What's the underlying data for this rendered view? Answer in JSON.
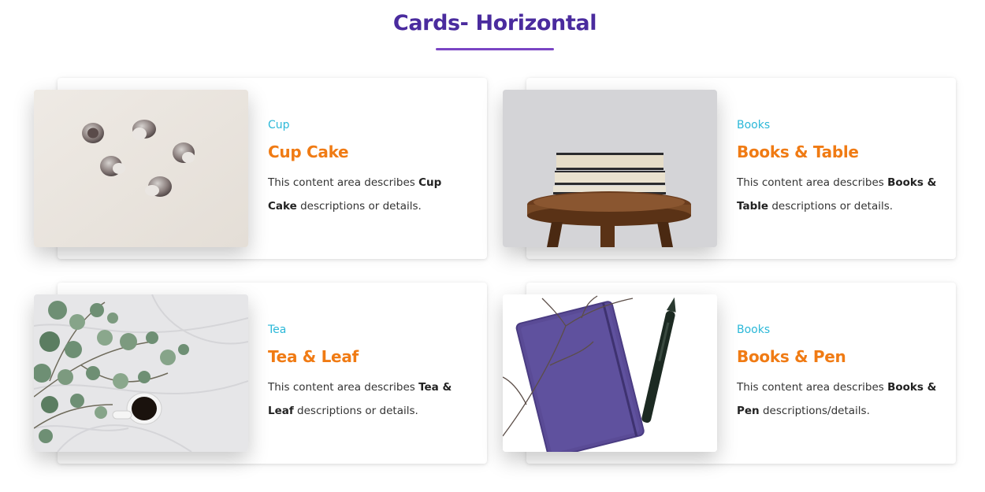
{
  "header": {
    "title": "Cards- Horizontal"
  },
  "cards": [
    {
      "category": "Cup",
      "title": "Cup Cake",
      "desc_pre": "This content area describes ",
      "desc_bold": "Cup Cake",
      "desc_post": " descriptions or details.",
      "image_icon": "coffee-capsules-photo"
    },
    {
      "category": "Books",
      "title": "Books & Table",
      "desc_pre": "This content area describes ",
      "desc_bold": "Books & Table",
      "desc_post": " descriptions or details.",
      "image_icon": "books-on-stool-photo"
    },
    {
      "category": "Tea",
      "title": "Tea & Leaf",
      "desc_pre": "This content area describes ",
      "desc_bold": "Tea & Leaf",
      "desc_post": " descriptions or details.",
      "image_icon": "tea-eucalyptus-photo"
    },
    {
      "category": "Books",
      "title": "Books & Pen",
      "desc_pre": "This content area describes ",
      "desc_bold": "Books & Pen",
      "desc_post": " descriptions/details.",
      "image_icon": "notebook-pen-photo"
    }
  ],
  "colors": {
    "title": "#4a2b9e",
    "underline": "#7a45c4",
    "category": "#2bb8d8",
    "card_title": "#f07b14",
    "text": "#333333"
  }
}
